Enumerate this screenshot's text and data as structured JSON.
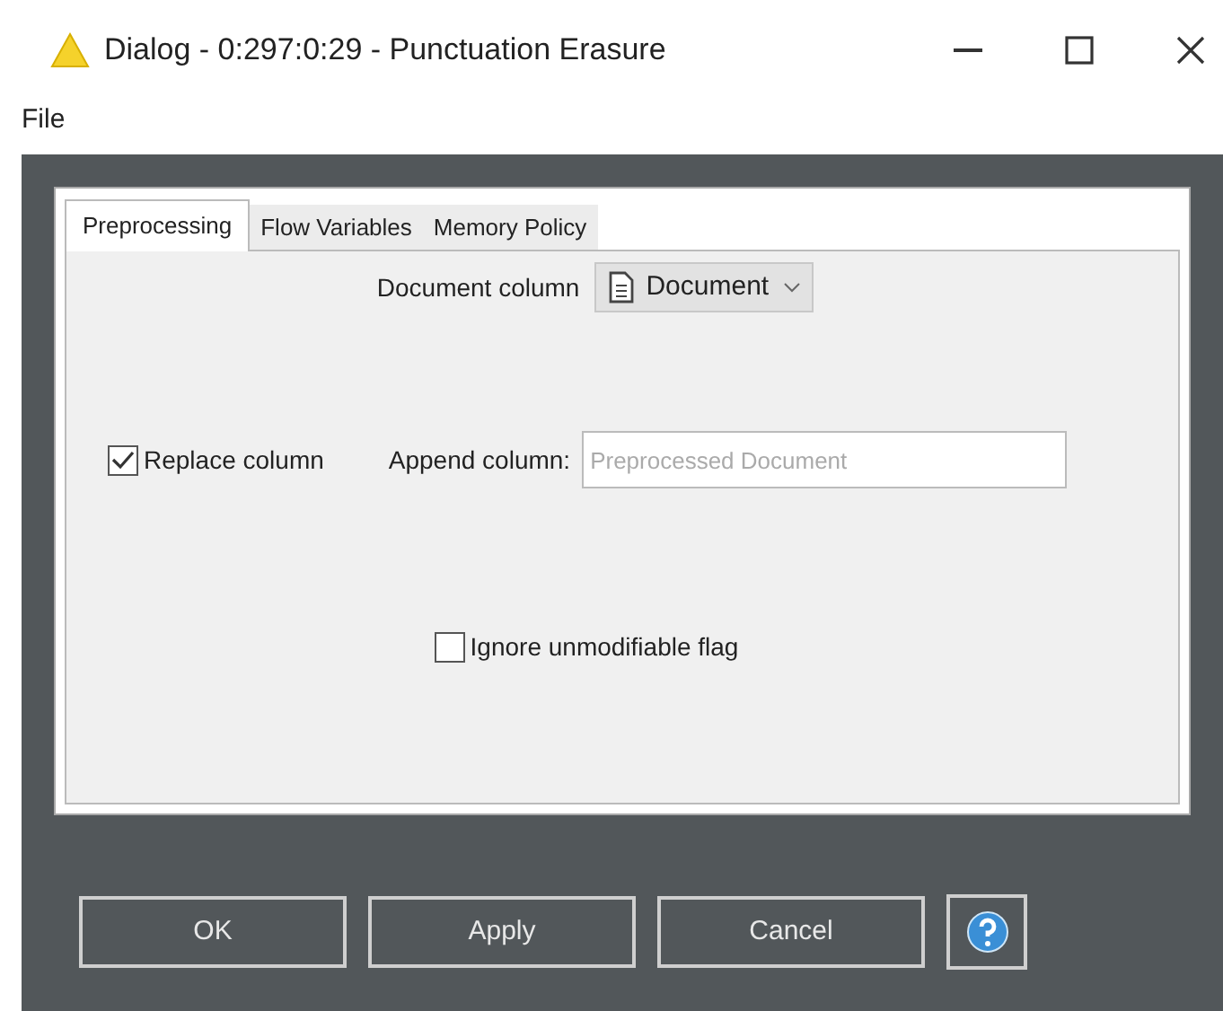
{
  "window": {
    "title": "Dialog - 0:297:0:29 - Punctuation Erasure",
    "warning": true
  },
  "menu": [
    "File"
  ],
  "tabs": [
    {
      "label": "Preprocessing",
      "selected": true
    },
    {
      "label": "Flow Variables",
      "selected": false
    },
    {
      "label": "Memory Policy",
      "selected": false
    }
  ],
  "document_column": {
    "label": "Document column",
    "value": "Document"
  },
  "replace_column": {
    "label": "Replace column",
    "checked": true
  },
  "append_column": {
    "label": "Append column:",
    "placeholder": "Preprocessed Document"
  },
  "ignore_flag": {
    "label": "Ignore unmodifiable flag",
    "checked": false
  },
  "buttons": [
    "OK",
    "Apply",
    "Cancel"
  ]
}
